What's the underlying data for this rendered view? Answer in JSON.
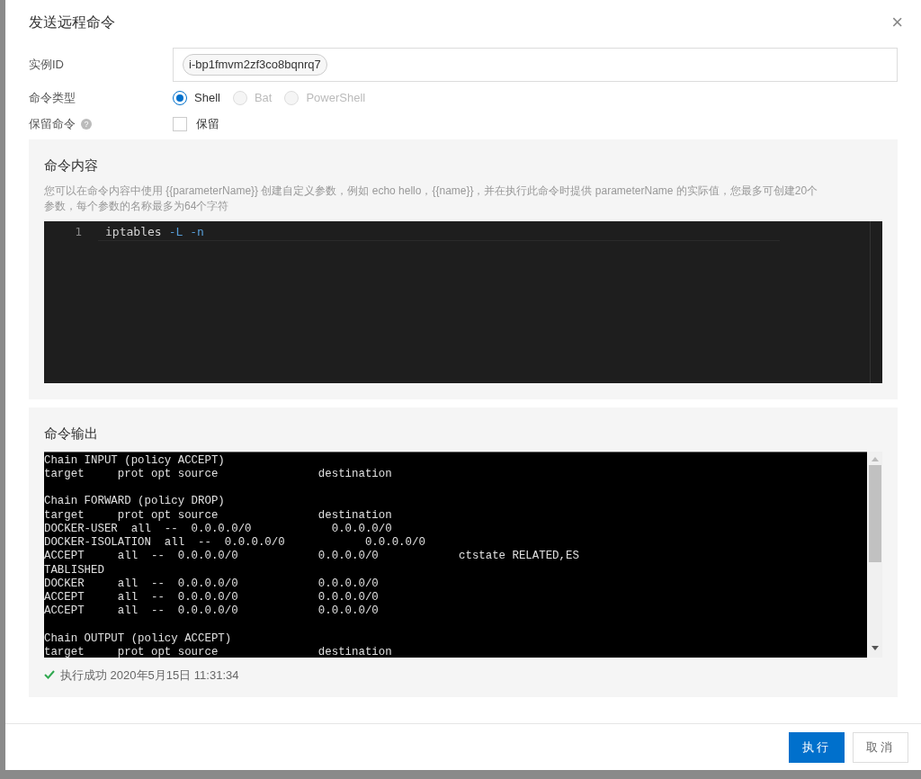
{
  "dialog": {
    "title": "发送远程命令",
    "close": "×"
  },
  "form": {
    "instance": {
      "label": "实例ID",
      "tags": [
        "i-bp1fmvm2zf3co8bqnrq7"
      ]
    },
    "command_type": {
      "label": "命令类型",
      "options": [
        {
          "label": "Shell",
          "selected": true,
          "disabled": false
        },
        {
          "label": "Bat",
          "selected": false,
          "disabled": true
        },
        {
          "label": "PowerShell",
          "selected": false,
          "disabled": true
        }
      ]
    },
    "keep": {
      "label": "保留命令",
      "help": "?",
      "option": "保留",
      "checked": false
    }
  },
  "content": {
    "title": "命令内容",
    "description": "您可以在命令内容中使用 {{parameterName}} 创建自定义参数，例如 echo hello，{{name}}，并在执行此命令时提供 parameterName 的实际值，您最多可创建20个参数，每个参数的名称最多为64个字符",
    "editor": {
      "lines": [
        {
          "number": "1",
          "tokens": [
            {
              "text": "iptables",
              "kind": "command"
            },
            {
              "text": "-L",
              "kind": "flag"
            },
            {
              "text": "-n",
              "kind": "flag"
            }
          ]
        }
      ]
    }
  },
  "output": {
    "title": "命令输出",
    "text": "Chain INPUT (policy ACCEPT)\ntarget     prot opt source               destination\n\nChain FORWARD (policy DROP)\ntarget     prot opt source               destination\nDOCKER-USER  all  --  0.0.0.0/0            0.0.0.0/0\nDOCKER-ISOLATION  all  --  0.0.0.0/0            0.0.0.0/0\nACCEPT     all  --  0.0.0.0/0            0.0.0.0/0            ctstate RELATED,ES\nTABLISHED\nDOCKER     all  --  0.0.0.0/0            0.0.0.0/0\nACCEPT     all  --  0.0.0.0/0            0.0.0.0/0\nACCEPT     all  --  0.0.0.0/0            0.0.0.0/0\n\nChain OUTPUT (policy ACCEPT)\ntarget     prot opt source               destination",
    "status": {
      "kind": "success",
      "text": "执行成功 2020年5月15日 11:31:34"
    }
  },
  "buttons": [
    {
      "label": "执行",
      "kind": "primary"
    },
    {
      "label": "取消",
      "kind": "secondary"
    }
  ]
}
